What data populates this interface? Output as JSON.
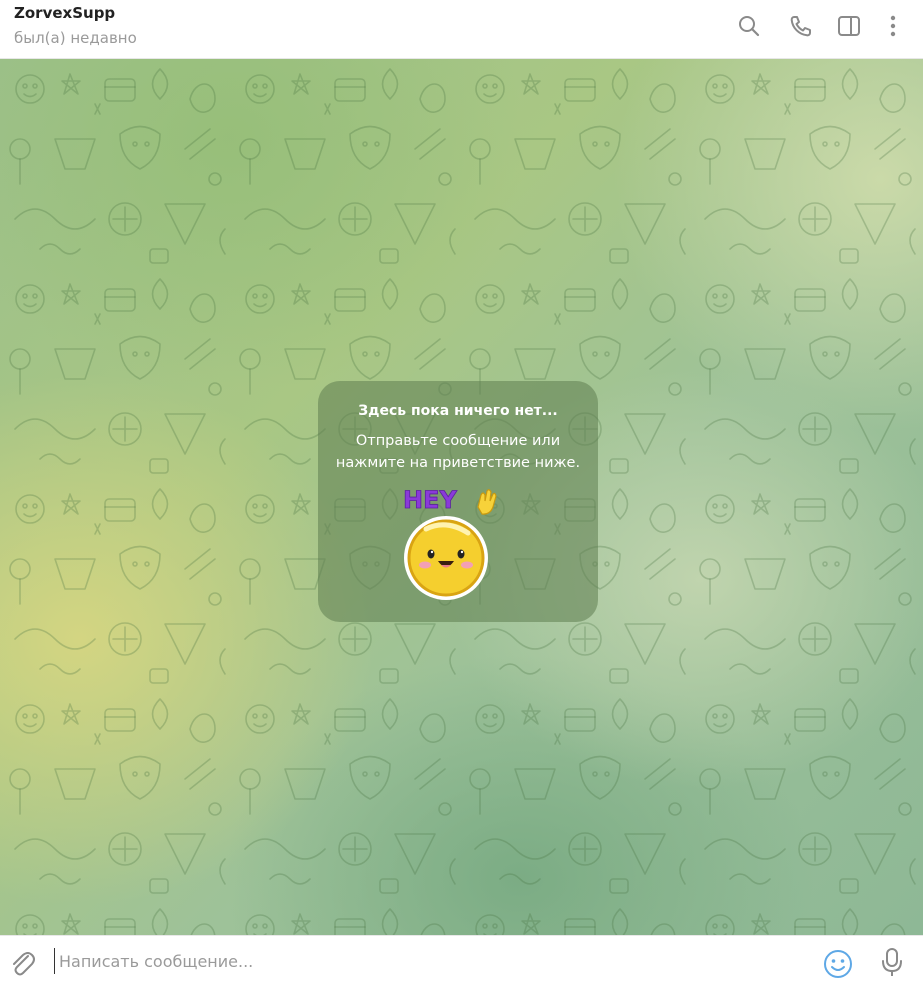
{
  "header": {
    "title": "ZorvexSupp",
    "status": "был(а) недавно",
    "icons": [
      "search-icon",
      "phone-icon",
      "sidebar-toggle-icon",
      "more-vertical-icon"
    ]
  },
  "empty_state": {
    "title": "Здесь пока ничего нет...",
    "line1": "Отправьте сообщение или",
    "line2": "нажмите на приветствие ниже.",
    "sticker_text": "HEY"
  },
  "composer": {
    "placeholder": "Написать сообщение...",
    "value": "",
    "icons": [
      "paperclip-icon",
      "emoji-icon",
      "microphone-icon"
    ]
  },
  "colors": {
    "accent": "#5ea8e6",
    "wallpaper": "#9cc08a",
    "sticker_text": "#8a3ad8",
    "sticker_face": "#f5cf2e"
  }
}
